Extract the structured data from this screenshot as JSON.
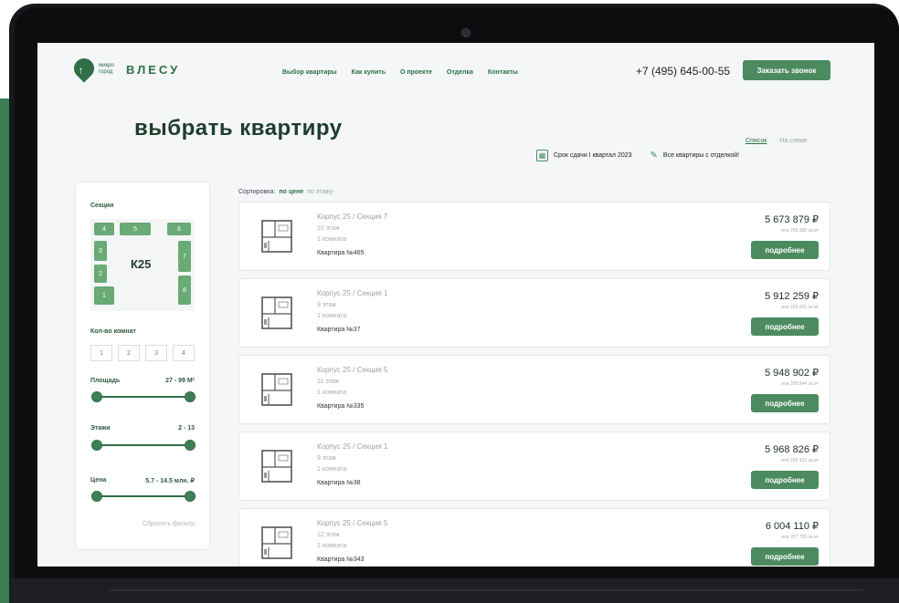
{
  "brand": {
    "small_text": "микро город",
    "name": "ВЛЕСУ",
    "pin_glyph": "↑",
    "color": "#2f7046"
  },
  "nav": [
    "Выбор квартиры",
    "Как купить",
    "О проекте",
    "Отделка",
    "Контакты"
  ],
  "phone": "+7 (495) 645-00-55",
  "call_button": "Заказать звонок",
  "page_title": "выбрать квартиру",
  "view_toggle": {
    "list": "Список",
    "schema": "На схеме"
  },
  "meta": {
    "deadline": "Срок сдачи I квартал 2023",
    "finish": "Все квартиры с отделкой!",
    "calendar_icon": "▦",
    "brush_icon": "✎"
  },
  "filters": {
    "sections_label": "Секции",
    "sections": [
      "1",
      "2",
      "3",
      "4",
      "5",
      "6",
      "7",
      "8"
    ],
    "building": "К25",
    "rooms_label": "Кол-во комнат",
    "rooms": [
      "1",
      "2",
      "3",
      "4"
    ],
    "area": {
      "label": "Площадь",
      "value": "27 - 99 М²"
    },
    "floors": {
      "label": "Этажи",
      "value": "2 - 13"
    },
    "price": {
      "label": "Цена",
      "value": "5.7 - 14.5 млн. ₽"
    },
    "reset": "Сбросить фильтр"
  },
  "sort": {
    "label": "Сортировка:",
    "by_price": "по цене",
    "by_floor": "по этажу"
  },
  "apartments": [
    {
      "building": "Корпус 25 / Секция 7",
      "floor": "10 этаж",
      "rooms": "1 комната",
      "number": "Квартира №465",
      "price": "5 673 879 ₽",
      "per_m2": "или 209 388 за м²",
      "button": "подробнее"
    },
    {
      "building": "Корпус 25 / Секция 1",
      "floor": "9 этаж",
      "rooms": "1 комната",
      "number": "Квартира №37",
      "price": "5 912 259 ₽",
      "per_m2": "или 205 655 за м²",
      "button": "подробнее"
    },
    {
      "building": "Корпус 25 / Секция 5",
      "floor": "11 этаж",
      "rooms": "1 комната",
      "number": "Квартира №335",
      "price": "5 948 902 ₽",
      "per_m2": "или 205 844 за м²",
      "button": "подробнее"
    },
    {
      "building": "Корпус 25 / Секция 1",
      "floor": "9 этаж",
      "rooms": "1 комната",
      "number": "Квартира №38",
      "price": "5 968 826 ₽",
      "per_m2": "или 209 432 за м²",
      "button": "подробнее"
    },
    {
      "building": "Корпус 25 / Секция 5",
      "floor": "12 этаж",
      "rooms": "1 комната",
      "number": "Квартира №343",
      "price": "6 004 110 ₽",
      "per_m2": "или 207 755 за м²",
      "button": "подробнее"
    }
  ]
}
